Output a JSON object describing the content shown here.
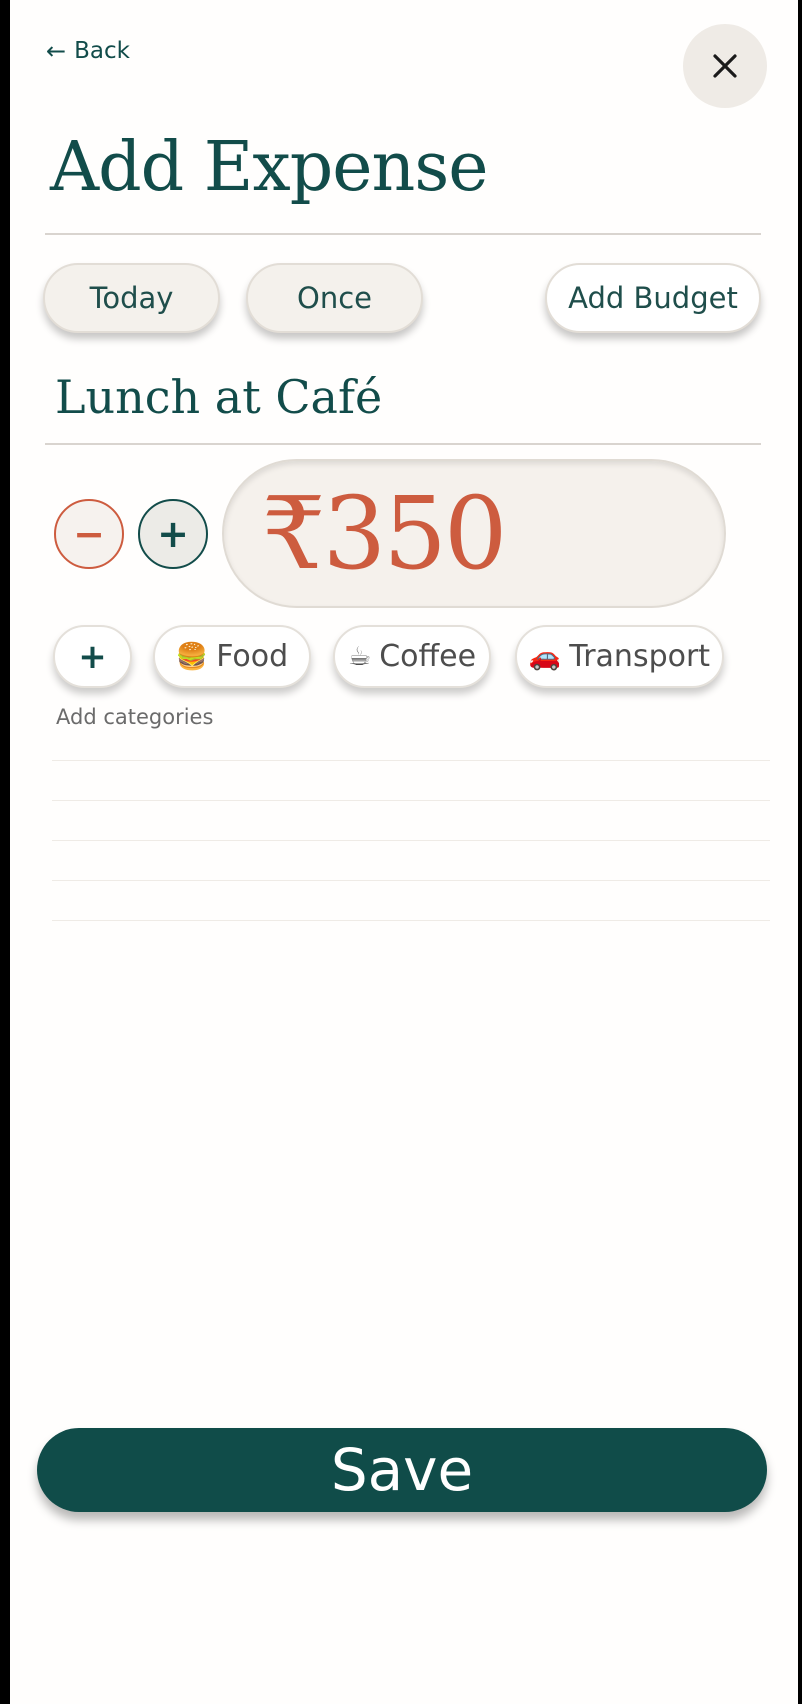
{
  "header": {
    "back_label": "Back",
    "back_icon": "arrow-left-icon",
    "close_icon": "close-icon",
    "title": "Add Expense"
  },
  "options": {
    "date": "Today",
    "frequency": "Once",
    "budget": "Add Budget"
  },
  "expense": {
    "description": "Lunch at Café",
    "amount": "₹350",
    "decrement_label": "−",
    "increment_label": "+"
  },
  "categories": {
    "add_label": "+",
    "items": [
      {
        "emoji": "🍔",
        "label": "Food"
      },
      {
        "emoji": "☕",
        "label": "Coffee"
      },
      {
        "emoji": "🚗",
        "label": "Transport"
      }
    ],
    "hint": "Add categories"
  },
  "actions": {
    "save_label": "Save"
  },
  "colors": {
    "primary": "#104c49",
    "accent": "#cd5c3f",
    "surface": "#f4f1ec"
  }
}
